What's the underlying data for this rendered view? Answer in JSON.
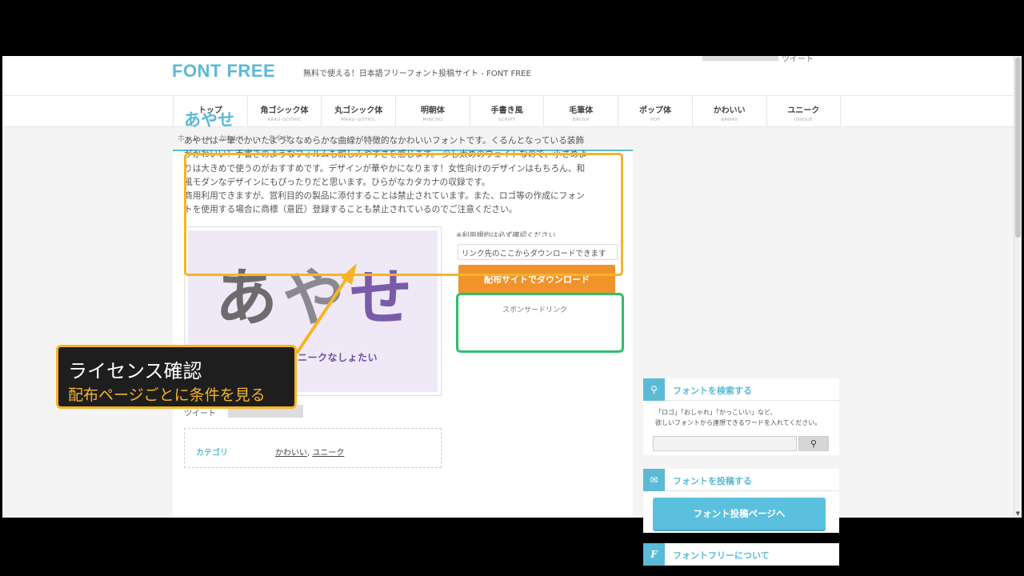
{
  "site": {
    "logo": "FONT FREE",
    "tagline": "無料で使える！日本語フリーフォント投稿サイト - FONT FREE",
    "header_tweet": "ツイート"
  },
  "nav": [
    {
      "label": "トップ",
      "sub": "TOP"
    },
    {
      "label": "角ゴシック体",
      "sub": "KAKU-GOTHIC"
    },
    {
      "label": "丸ゴシック体",
      "sub": "MARU-GOTHIC"
    },
    {
      "label": "明朝体",
      "sub": "MINCHO"
    },
    {
      "label": "手書き風",
      "sub": "SCRIPT"
    },
    {
      "label": "毛筆体",
      "sub": "BRUSH"
    },
    {
      "label": "ポップ体",
      "sub": "POP"
    },
    {
      "label": "かわいい",
      "sub": "KAWAII"
    },
    {
      "label": "ユニーク",
      "sub": "UNIQUE"
    }
  ],
  "breadcrumb": [
    "ホーム",
    ">",
    "かわいい",
    ">",
    "あやせ"
  ],
  "font": {
    "title": "あやせ",
    "description": [
      "あやせは一筆でかいたようななめらかな曲線が特徴的なかわいいフォントです。くるんとなっている装飾",
      "がかわいい！手書きのようなフォルムも親しみやすさを感じます。 少し太めのウェイトなので、小さめよ",
      "りは大きめで使うのがおすすめです。デザインが華やかになります！女性向けのデザインはもちろん、和",
      "風モダンなデザインにもぴったりだと思います。ひらがなカタカナの収録です。",
      "商用利用できますが、営利目的の製品に添付することは禁止されています。また、ロゴ等の作成にフォン",
      "トを使用する場合に商標（意匠）登録することも禁止されているのでご注意ください。"
    ],
    "preview_big": [
      "あ",
      "や",
      "せ"
    ],
    "preview_small": "あいのあるユニークなしょたい",
    "tweet_label": "ツイート",
    "category_key": "カテゴリ",
    "categories": [
      "かわいい",
      "ユニーク"
    ],
    "category_sep": ", "
  },
  "download": {
    "terms_note": "※利用規約は必ず確認ください",
    "link_note": "リンク先のここからダウンロードできます",
    "button": "配布サイトでダウンロード",
    "sponsor": "スポンサードリンク"
  },
  "sidebar": {
    "search": {
      "title": "フォントを検索する",
      "text_1": "「ロゴ」「おしゃれ」「かっこいい」など、",
      "text_2": "欲しいフォントから連想できるワードを入れてください。",
      "placeholder": ""
    },
    "post": {
      "title": "フォントを投稿する",
      "button": "フォント投稿ページへ"
    },
    "about": {
      "title": "フォントフリーについて"
    }
  },
  "annotation": {
    "title": "ライセンス確認",
    "subtitle": "配布ページごとに条件を見る"
  },
  "colors": {
    "accent": "#5bbad5",
    "download": "#f0932b",
    "highlight_orange": "#f6b426",
    "highlight_green": "#2fbf6e"
  },
  "icons": {
    "search": "magnifier-icon",
    "post": "envelope-icon",
    "about": "font-f-icon"
  }
}
